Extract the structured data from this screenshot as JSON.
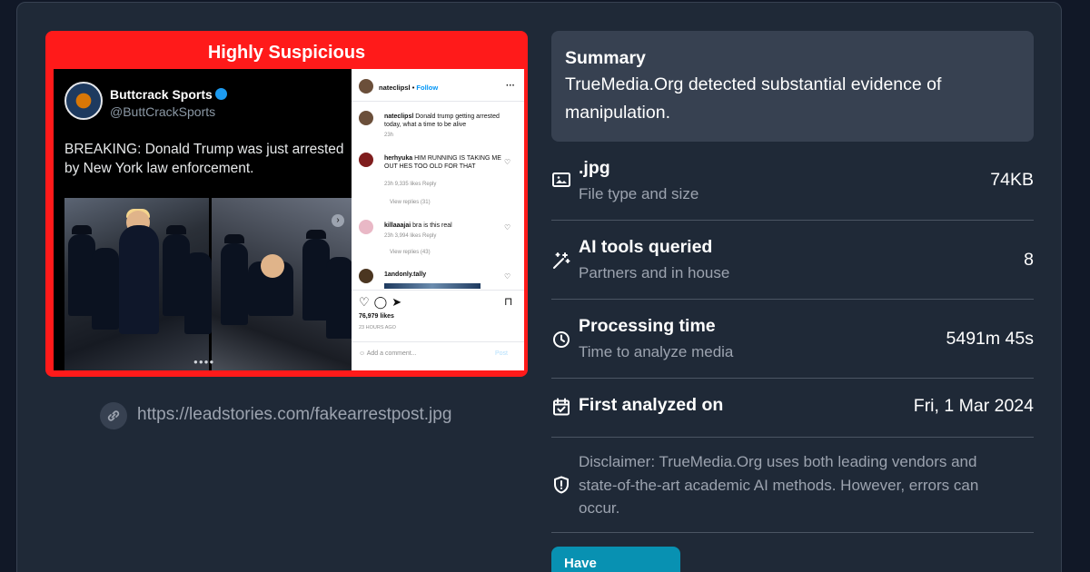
{
  "media": {
    "verdict_label": "Highly Suspicious",
    "verdict_color": "#ff1a1a",
    "embedded": {
      "tweet": {
        "account_name": "Buttcrack Sports",
        "handle": "@ButtCrackSports",
        "text": "BREAKING: Donald Trump was just arrested by New York law enforcement."
      },
      "instagram": {
        "username": "nateclipsl",
        "follow_label": "Follow",
        "caption_user": "nateclipsl",
        "caption": "Donald trump getting arrested today, what a time to be alive",
        "caption_time": "23h",
        "comments": [
          {
            "user": "herhyuka",
            "text": "HIM RUNNING IS TAKING ME OUT HES TOO OLD FOR THAT",
            "meta": "23h   9,335 likes   Reply",
            "replies": "View replies (31)"
          },
          {
            "user": "killaaajai",
            "text": "bra is this real",
            "meta": "23h   3,994 likes   Reply",
            "replies": "View replies (43)"
          },
          {
            "user": "1andonly.tally",
            "text": "",
            "meta": "",
            "replies": ""
          }
        ],
        "likes": "76,979 likes",
        "time_ago": "23 HOURS AGO",
        "add_comment": "Add a comment...",
        "post_label": "Post"
      }
    }
  },
  "source": {
    "url": "https://leadstories.com/fakearrestpost.jpg",
    "icon": "link-icon"
  },
  "summary": {
    "title": "Summary",
    "text": "TrueMedia.Org detected substantial evidence of manipulation."
  },
  "details": [
    {
      "icon": "image-icon",
      "title": ".jpg",
      "subtitle": "File type and size",
      "value": "74KB"
    },
    {
      "icon": "magic-wand-icon",
      "title": "AI tools queried",
      "subtitle": "Partners and in house",
      "value": "8"
    },
    {
      "icon": "clock-icon",
      "title": "Processing time",
      "subtitle": "Time to analyze media",
      "value": "5491m 45s"
    },
    {
      "icon": "calendar-check-icon",
      "title": "First analyzed on",
      "subtitle": "",
      "value": "Fri, 1 Mar 2024"
    }
  ],
  "disclaimer": {
    "icon": "shield-alert-icon",
    "text": "Disclaimer: TrueMedia.Org uses both leading vendors and state-of-the-art academic AI methods. However, errors can occur."
  },
  "feedback_button": "Have Feedback?",
  "colors": {
    "page_bg": "#111827",
    "card_bg": "#1f2937",
    "summary_bg": "#374151",
    "accent": "#0891b2",
    "muted_text": "#9ca3af"
  }
}
